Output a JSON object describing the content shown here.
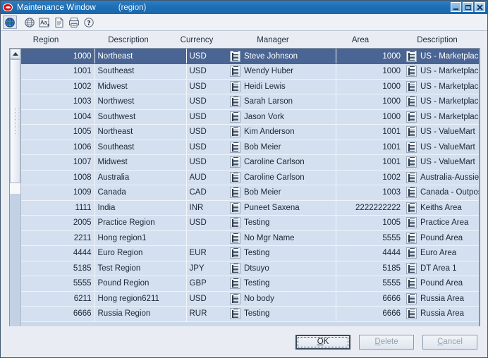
{
  "window": {
    "title": "Maintenance Window",
    "subtitle": "(region)",
    "logo_icon": "oracle-logo-icon",
    "minimize_label": "_",
    "maximize_label": "□",
    "close_label": "✕"
  },
  "toolbar": {
    "buttons": [
      {
        "name": "globe-color-icon",
        "label": ""
      },
      {
        "name": "globe-gray-icon",
        "label": ""
      },
      {
        "name": "find-text-icon",
        "label": ""
      },
      {
        "name": "document-icon",
        "label": ""
      },
      {
        "name": "print-icon",
        "label": ""
      },
      {
        "name": "help-icon",
        "label": ""
      }
    ]
  },
  "grid": {
    "headers": [
      "Region",
      "Description",
      "Currency",
      "Manager",
      "Area",
      "Description"
    ],
    "lov_icon": "list-of-values-icon",
    "selected_row_index": 0,
    "rows": [
      {
        "region": "1000",
        "description": "Northeast",
        "currency": "USD",
        "manager": "Steve Johnson",
        "area": "1000",
        "area_description": "US - Marketplace"
      },
      {
        "region": "1001",
        "description": "Southeast",
        "currency": "USD",
        "manager": "Wendy Huber",
        "area": "1000",
        "area_description": "US - Marketplace"
      },
      {
        "region": "1002",
        "description": "Midwest",
        "currency": "USD",
        "manager": "Heidi Lewis",
        "area": "1000",
        "area_description": "US - Marketplace"
      },
      {
        "region": "1003",
        "description": "Northwest",
        "currency": "USD",
        "manager": "Sarah Larson",
        "area": "1000",
        "area_description": "US - Marketplace"
      },
      {
        "region": "1004",
        "description": "Southwest",
        "currency": "USD",
        "manager": "Jason Vork",
        "area": "1000",
        "area_description": "US - Marketplace"
      },
      {
        "region": "1005",
        "description": "Northeast",
        "currency": "USD",
        "manager": "Kim Anderson",
        "area": "1001",
        "area_description": "US - ValueMart"
      },
      {
        "region": "1006",
        "description": "Southeast",
        "currency": "USD",
        "manager": "Bob Meier",
        "area": "1001",
        "area_description": "US - ValueMart"
      },
      {
        "region": "1007",
        "description": "Midwest",
        "currency": "USD",
        "manager": "Caroline Carlson",
        "area": "1001",
        "area_description": "US - ValueMart"
      },
      {
        "region": "1008",
        "description": "Australia",
        "currency": "AUD",
        "manager": "Caroline Carlson",
        "area": "1002",
        "area_description": "Australia-AussieMart"
      },
      {
        "region": "1009",
        "description": "Canada",
        "currency": "CAD",
        "manager": "Bob Meier",
        "area": "1003",
        "area_description": "Canada - Outpost"
      },
      {
        "region": "1111",
        "description": "India",
        "currency": "INR",
        "manager": "Puneet Saxena",
        "area": "2222222222",
        "area_description": "Keiths Area"
      },
      {
        "region": "2005",
        "description": "Practice Region",
        "currency": "USD",
        "manager": "Testing",
        "area": "1005",
        "area_description": "Practice Area"
      },
      {
        "region": "2211",
        "description": "Hong region1",
        "currency": "",
        "manager": "No Mgr Name",
        "area": "5555",
        "area_description": "Pound Area"
      },
      {
        "region": "4444",
        "description": "Euro Region",
        "currency": "EUR",
        "manager": "Testing",
        "area": "4444",
        "area_description": "Euro Area"
      },
      {
        "region": "5185",
        "description": "Test Region",
        "currency": "JPY",
        "manager": "Dtsuyo",
        "area": "5185",
        "area_description": "DT Area 1"
      },
      {
        "region": "5555",
        "description": "Pound Region",
        "currency": "GBP",
        "manager": "Testing",
        "area": "5555",
        "area_description": "Pound Area"
      },
      {
        "region": "6211",
        "description": "Hong region6211",
        "currency": "USD",
        "manager": "No body",
        "area": "6666",
        "area_description": "Russia Area"
      },
      {
        "region": "6666",
        "description": "Russia Region",
        "currency": "RUR",
        "manager": "Testing",
        "area": "6666",
        "area_description": "Russia Area"
      }
    ]
  },
  "scrollbar": {
    "up_arrow": "scroll-up-arrow-icon",
    "down_arrow": "scroll-down-arrow-icon"
  },
  "buttons": {
    "ok": {
      "label": "OK",
      "mnemonic": "O",
      "rest": "K",
      "enabled": true,
      "focused": true
    },
    "delete": {
      "label": "Delete",
      "mnemonic": "D",
      "rest": "elete",
      "enabled": false,
      "focused": false
    },
    "cancel": {
      "label": "Cancel",
      "mnemonic": "C",
      "rest": "ancel",
      "enabled": false,
      "focused": false
    }
  },
  "colors": {
    "titlebar": "#1e6fb5",
    "selected_row": "#4a6593",
    "row": "#d4e0f0",
    "window_bg": "#e9edf3"
  }
}
